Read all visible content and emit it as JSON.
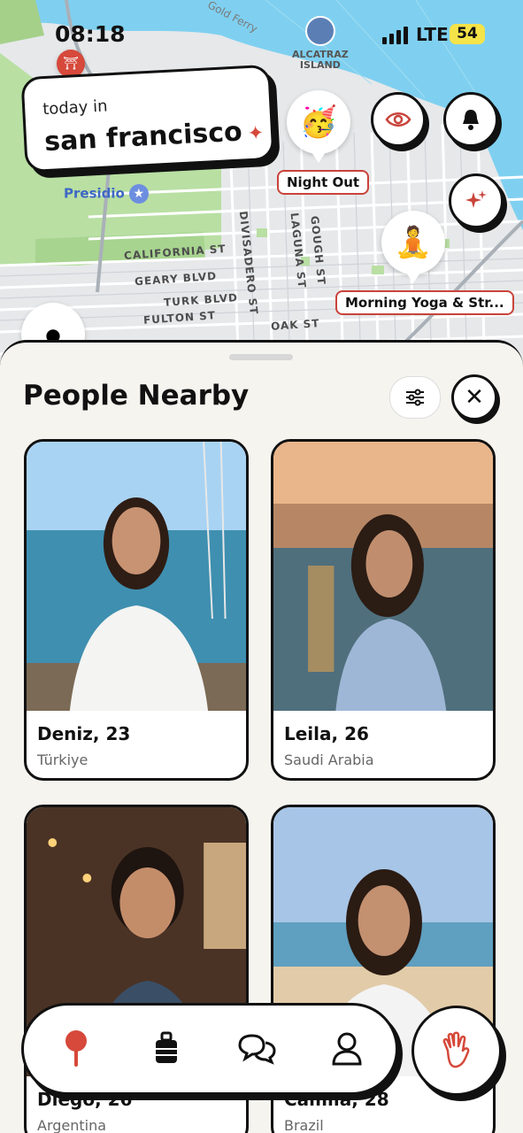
{
  "status_bar": {
    "time": "08:18",
    "network": "LTE",
    "battery": "54"
  },
  "map": {
    "today_label": "today in",
    "city": "san francisco",
    "city_sparkle": "✦",
    "landmarks": {
      "presidio": "Presidio",
      "alcatraz_line1": "ALCATRAZ",
      "alcatraz_line2": "ISLAND",
      "gold_ferry": "Gold Ferry"
    },
    "streets": [
      "CALIFORNIA ST",
      "GEARY BLVD",
      "TURK BLVD",
      "FULTON ST",
      "OAK ST",
      "DIVISADERO ST",
      "GOUGH ST",
      "LAGUNA ST"
    ],
    "events": [
      {
        "label": "Night Out",
        "emoji": "🥳"
      },
      {
        "label": "Morning Yoga & Str...",
        "emoji": "🧘"
      }
    ],
    "icons": {
      "eye": "eye-icon",
      "bell": "bell-icon",
      "sparkles": "sparkles-icon"
    }
  },
  "sheet": {
    "title": "People Nearby",
    "people": [
      {
        "name": "Deniz, 23",
        "country": "Türkiye"
      },
      {
        "name": "Leila, 26",
        "country": "Saudi Arabia"
      },
      {
        "name": "Diego, 26",
        "country": "Argentina"
      },
      {
        "name": "Camila, 28",
        "country": "Brazil"
      }
    ]
  },
  "nav": {
    "items": [
      "map-pin-icon",
      "luggage-icon",
      "chat-icon",
      "profile-icon"
    ],
    "active": "map-pin-icon",
    "action": "wave-hand-icon"
  },
  "colors": {
    "accent": "#d6493b",
    "ink": "#111111",
    "sheet_bg": "#f6f4ef"
  }
}
